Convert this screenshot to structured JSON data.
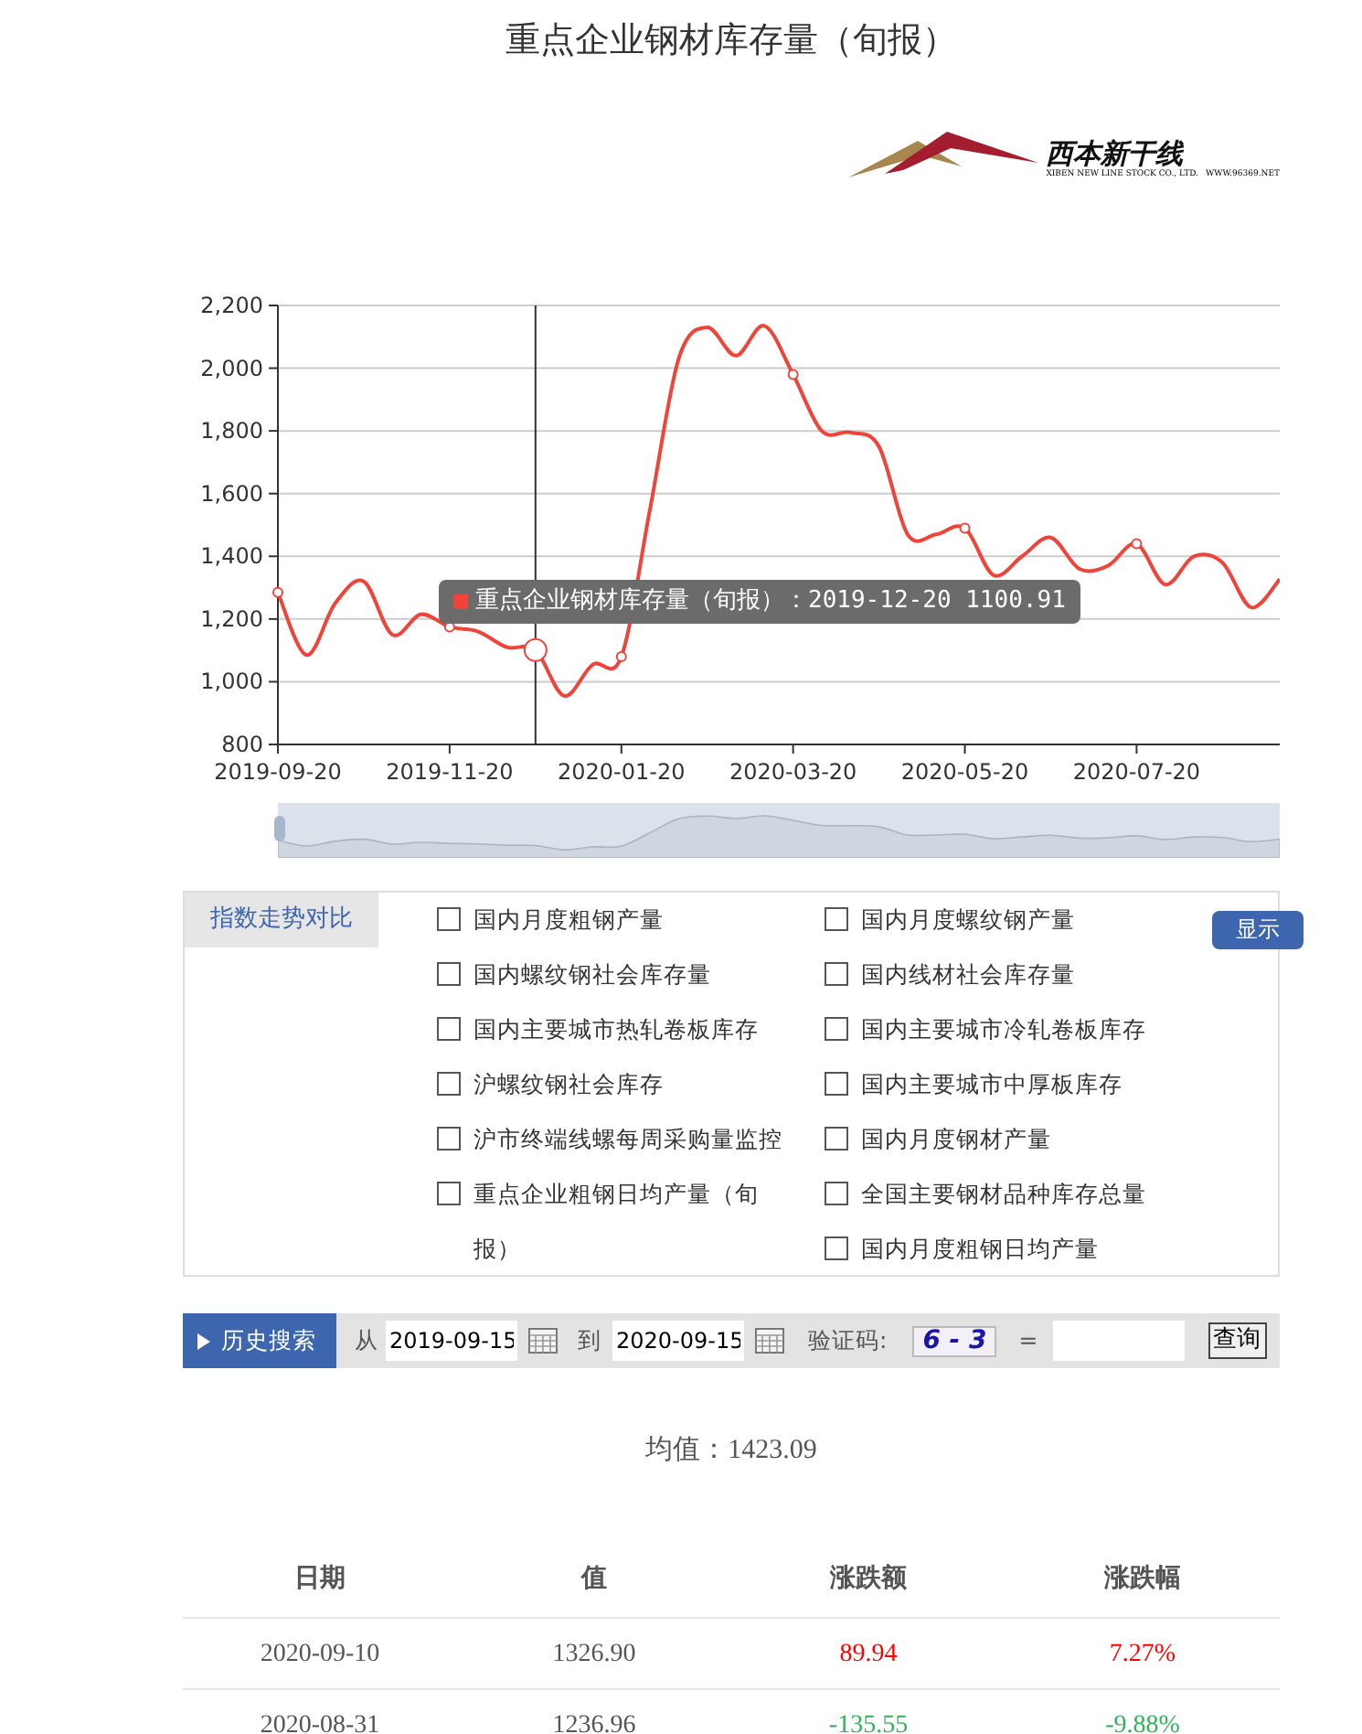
{
  "title": "重点企业钢材库存量（旬报）",
  "logo": {
    "name": "西本新干线",
    "tagline": "XIBEN NEW LINE STOCK CO., LTD.",
    "url": "WWW.96369.NET"
  },
  "chart": {
    "chart_data": {
      "type": "line",
      "categories": [
        "2019-09-20",
        null,
        null,
        null,
        null,
        null,
        "2019-11-20",
        null,
        null,
        null,
        null,
        null,
        "2020-01-20",
        null,
        null,
        null,
        null,
        null,
        "2020-03-20",
        null,
        null,
        null,
        null,
        null,
        "2020-05-20",
        null,
        null,
        null,
        null,
        null,
        "2020-07-20",
        null,
        null,
        null,
        null,
        null
      ],
      "series": [
        {
          "name": "重点企业钢材库存量（旬报）",
          "color": "#f0443a",
          "values": [
            1285,
            1085,
            1250,
            1320,
            1150,
            1215,
            1175,
            1160,
            1110,
            1101,
            955,
            1055,
            1080,
            1550,
            2030,
            2130,
            2040,
            2135,
            1980,
            1800,
            1795,
            1750,
            1470,
            1470,
            1490,
            1340,
            1400,
            1460,
            1360,
            1370,
            1440,
            1310,
            1400,
            1380,
            1237,
            1327
          ]
        }
      ],
      "ylim": [
        800,
        2200
      ],
      "grid": true,
      "yticks": [
        {
          "value": 800,
          "label": "800"
        },
        {
          "value": 1000,
          "label": "1,000"
        },
        {
          "value": 1200,
          "label": "1,200"
        },
        {
          "value": 1400,
          "label": "1,400"
        },
        {
          "value": 1600,
          "label": "1,600"
        },
        {
          "value": 1800,
          "label": "1,800"
        },
        {
          "value": 2000,
          "label": "2,000"
        },
        {
          "value": 2200,
          "label": "2,200"
        }
      ]
    },
    "tooltip": {
      "separator": "：",
      "date": "2019-12-20",
      "value": "1100.91"
    },
    "zoom": {
      "level": 1
    }
  },
  "compare": {
    "tab": "指数走势对比",
    "button": "显示",
    "columns": [
      [
        {
          "label": "国内月度粗钢产量",
          "checked": false
        },
        {
          "label": "国内螺纹钢社会库存量",
          "checked": false
        },
        {
          "label": "国内主要城市热轧卷板库存",
          "checked": false
        },
        {
          "label": "沪螺纹钢社会库存",
          "checked": false
        },
        {
          "label": "沪市终端线螺每周采购量监控",
          "checked": false
        },
        {
          "label": "重点企业粗钢日均产量（旬报）",
          "checked": false
        }
      ],
      [
        {
          "label": "国内月度螺纹钢产量",
          "checked": false
        },
        {
          "label": "国内线材社会库存量",
          "checked": false
        },
        {
          "label": "国内主要城市冷轧卷板库存",
          "checked": false
        },
        {
          "label": "国内主要城市中厚板库存",
          "checked": false
        },
        {
          "label": "国内月度钢材产量",
          "checked": false
        },
        {
          "label": "全国主要钢材品种库存总量",
          "checked": false
        },
        {
          "label": "国内月度粗钢日均产量",
          "checked": false
        }
      ]
    ]
  },
  "search": {
    "label": "历史搜索",
    "from_label": "从",
    "from": "2019-09-15",
    "to_label": "到",
    "to": "2020-09-15",
    "captcha_label": "验证码:",
    "captcha": "6 - 3",
    "equals": "=",
    "button": "查询"
  },
  "mean": "均值：1423.09",
  "table": {
    "columns": [
      "日期",
      "值",
      "涨跌额",
      "涨跌幅"
    ],
    "rows": [
      {
        "date": "2020-09-10",
        "value": "1326.90",
        "change": "89.94",
        "percent": "7.27%",
        "color": "#ff0000"
      },
      {
        "date": "2020-08-31",
        "value": "1236.96",
        "change": "-135.55",
        "percent": "-9.88%",
        "color": "#2fb35a"
      }
    ]
  }
}
